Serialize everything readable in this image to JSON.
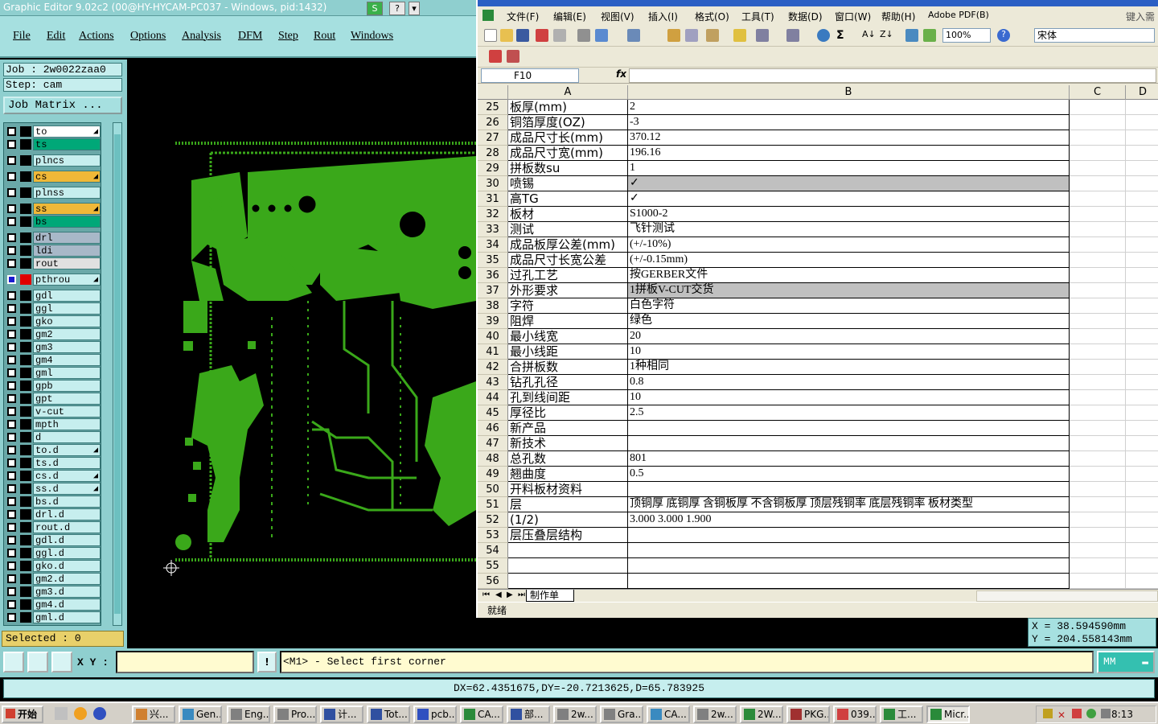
{
  "ge": {
    "title": "Graphic Editor 9.02c2 (00@HY-HYCAM-PC037 - Windows, pid:1432)",
    "menu": [
      "File",
      "Edit",
      "Actions",
      "Options",
      "Analysis",
      "DFM",
      "Step",
      "Rout",
      "Windows"
    ],
    "job": "Job : 2w0022zaa0",
    "step": "Step: cam",
    "job_matrix": "Job Matrix ...",
    "selected": "Selected : 0",
    "layers": [
      {
        "name": "to",
        "bg": "#ffffff",
        "color": "#000000",
        "flag": true,
        "sel": false
      },
      {
        "name": "ts",
        "bg": "#00a878",
        "color": "#000000",
        "flag": false,
        "sel": false
      },
      {
        "name": "plncs",
        "bg": "#c6eeee",
        "color": "#000000",
        "flag": false,
        "sel": false
      },
      {
        "name": "cs",
        "bg": "#f0b838",
        "color": "#00a000",
        "flag": true,
        "sel": false
      },
      {
        "name": "plnss",
        "bg": "#c6eeee",
        "color": "#000000",
        "flag": false,
        "sel": false
      },
      {
        "name": "ss",
        "bg": "#f0b838",
        "color": "#000000",
        "flag": true,
        "sel": false
      },
      {
        "name": "bs",
        "bg": "#00a878",
        "color": "#000000",
        "flag": false,
        "sel": false
      },
      {
        "name": "drl",
        "bg": "#a8b8c8",
        "color": "#000000",
        "flag": false,
        "sel": false
      },
      {
        "name": "ldi",
        "bg": "#a8b8c8",
        "color": "#000000",
        "flag": false,
        "sel": false
      },
      {
        "name": "rout",
        "bg": "#e0e0e0",
        "color": "#000000",
        "flag": false,
        "sel": false
      },
      {
        "name": "pthrou",
        "bg": "#c6eeee",
        "color": "#e00000",
        "flag": true,
        "sel": true
      },
      {
        "name": "gdl",
        "bg": "#c6eeee",
        "color": "#000000",
        "flag": false,
        "sel": false
      },
      {
        "name": "ggl",
        "bg": "#c6eeee",
        "color": "#000000",
        "flag": false,
        "sel": false
      },
      {
        "name": "gko",
        "bg": "#c6eeee",
        "color": "#000000",
        "flag": false,
        "sel": false
      },
      {
        "name": "gm2",
        "bg": "#c6eeee",
        "color": "#000000",
        "flag": false,
        "sel": false
      },
      {
        "name": "gm3",
        "bg": "#c6eeee",
        "color": "#000000",
        "flag": false,
        "sel": false
      },
      {
        "name": "gm4",
        "bg": "#c6eeee",
        "color": "#000000",
        "flag": false,
        "sel": false
      },
      {
        "name": "gml",
        "bg": "#c6eeee",
        "color": "#000000",
        "flag": false,
        "sel": false
      },
      {
        "name": "gpb",
        "bg": "#c6eeee",
        "color": "#000000",
        "flag": false,
        "sel": false
      },
      {
        "name": "gpt",
        "bg": "#c6eeee",
        "color": "#000000",
        "flag": false,
        "sel": false
      },
      {
        "name": "v-cut",
        "bg": "#c6eeee",
        "color": "#000000",
        "flag": false,
        "sel": false
      },
      {
        "name": "mpth",
        "bg": "#c6eeee",
        "color": "#000000",
        "flag": false,
        "sel": false
      },
      {
        "name": "d",
        "bg": "#c6eeee",
        "color": "#000000",
        "flag": false,
        "sel": false
      },
      {
        "name": "to.d",
        "bg": "#c6eeee",
        "color": "#000000",
        "flag": true,
        "sel": false
      },
      {
        "name": "ts.d",
        "bg": "#c6eeee",
        "color": "#000000",
        "flag": false,
        "sel": false
      },
      {
        "name": "cs.d",
        "bg": "#c6eeee",
        "color": "#000000",
        "flag": true,
        "sel": false
      },
      {
        "name": "ss.d",
        "bg": "#c6eeee",
        "color": "#000000",
        "flag": true,
        "sel": false
      },
      {
        "name": "bs.d",
        "bg": "#c6eeee",
        "color": "#000000",
        "flag": false,
        "sel": false
      },
      {
        "name": "drl.d",
        "bg": "#c6eeee",
        "color": "#000000",
        "flag": false,
        "sel": false
      },
      {
        "name": "rout.d",
        "bg": "#c6eeee",
        "color": "#000000",
        "flag": false,
        "sel": false
      },
      {
        "name": "gdl.d",
        "bg": "#c6eeee",
        "color": "#000000",
        "flag": false,
        "sel": false
      },
      {
        "name": "ggl.d",
        "bg": "#c6eeee",
        "color": "#000000",
        "flag": false,
        "sel": false
      },
      {
        "name": "gko.d",
        "bg": "#c6eeee",
        "color": "#000000",
        "flag": false,
        "sel": false
      },
      {
        "name": "gm2.d",
        "bg": "#c6eeee",
        "color": "#000000",
        "flag": false,
        "sel": false
      },
      {
        "name": "gm3.d",
        "bg": "#c6eeee",
        "color": "#000000",
        "flag": false,
        "sel": false
      },
      {
        "name": "gm4.d",
        "bg": "#c6eeee",
        "color": "#000000",
        "flag": false,
        "sel": false
      },
      {
        "name": "gml.d",
        "bg": "#c6eeee",
        "color": "#000000",
        "flag": false,
        "sel": false
      }
    ],
    "coords": {
      "x": "X = 38.594590mm",
      "y": "Y = 204.558143mm"
    },
    "xy_label": "X Y :",
    "prompt": "<M1> - Select first corner",
    "prompt_btn": "!",
    "units": "MM",
    "dx_line": "DX=62.4351675,DY=-20.7213625,D=65.783925",
    "pcb_color": "#3aa81a"
  },
  "excel": {
    "menu": [
      "文件(F)",
      "编辑(E)",
      "视图(V)",
      "插入(I)",
      "格式(O)",
      "工具(T)",
      "数据(D)",
      "窗口(W)",
      "帮助(H)",
      "Adobe PDF(B)"
    ],
    "search_hint": "键入需要",
    "zoom": "100%",
    "font": "宋体",
    "name_box": "F10",
    "fx": "fx",
    "columns": [
      "A",
      "B",
      "C",
      "D"
    ],
    "rows": [
      {
        "n": "25",
        "a": "板厚(mm)",
        "b": "2",
        "gray": false
      },
      {
        "n": "26",
        "a": "铜箔厚度(OZ)",
        "b": "-3",
        "gray": false
      },
      {
        "n": "27",
        "a": "成品尺寸长(mm)",
        "b": "370.12",
        "gray": false
      },
      {
        "n": "28",
        "a": "成品尺寸宽(mm)",
        "b": "196.16",
        "gray": false
      },
      {
        "n": "29",
        "a": "拼板数su",
        "b": "1",
        "gray": false
      },
      {
        "n": "30",
        "a": "喷锡",
        "b": "✓",
        "gray": true
      },
      {
        "n": "31",
        "a": "高TG",
        "b": "✓",
        "gray": false
      },
      {
        "n": "32",
        "a": "板材",
        "b": "S1000-2",
        "gray": false
      },
      {
        "n": "33",
        "a": "测试",
        "b": "飞针测试",
        "gray": false
      },
      {
        "n": "34",
        "a": "成品板厚公差(mm)",
        "b": "(+/-10%)",
        "gray": false
      },
      {
        "n": "35",
        "a": "成品尺寸长宽公差",
        "b": "(+/-0.15mm)",
        "gray": false
      },
      {
        "n": "36",
        "a": "过孔工艺",
        "b": "按GERBER文件",
        "gray": false
      },
      {
        "n": "37",
        "a": "外形要求",
        "b": "1拼板V-CUT交货",
        "gray": true
      },
      {
        "n": "38",
        "a": "字符",
        "b": "白色字符",
        "gray": false
      },
      {
        "n": "39",
        "a": "阻焊",
        "b": "绿色",
        "gray": false
      },
      {
        "n": "40",
        "a": "最小线宽",
        "b": "20",
        "gray": false
      },
      {
        "n": "41",
        "a": "最小线距",
        "b": "10",
        "gray": false
      },
      {
        "n": "42",
        "a": "合拼板数",
        "b": "1种相同",
        "gray": false
      },
      {
        "n": "43",
        "a": "钻孔孔径",
        "b": "0.8",
        "gray": false
      },
      {
        "n": "44",
        "a": "孔到线间距",
        "b": "10",
        "gray": false
      },
      {
        "n": "45",
        "a": "厚径比",
        "b": "2.5",
        "gray": false
      },
      {
        "n": "46",
        "a": "新产品",
        "b": "",
        "gray": false
      },
      {
        "n": "47",
        "a": "新技术",
        "b": "",
        "gray": false
      },
      {
        "n": "48",
        "a": "总孔数",
        "b": "801",
        "gray": false
      },
      {
        "n": "49",
        "a": "翘曲度",
        "b": "0.5",
        "gray": false
      },
      {
        "n": "50",
        "a": "开料板材资料",
        "b": "",
        "gray": false
      },
      {
        "n": "51",
        "a": "层",
        "b": "顶铜厚  底铜厚  含铜板厚  不含铜板厚  顶层残铜率  底层残铜率  板材类型",
        "gray": false
      },
      {
        "n": "52",
        "a": "(1/2)",
        "b": "3.000   3.000    1.900",
        "gray": false
      },
      {
        "n": "53",
        "a": "层压叠层结构",
        "b": "",
        "gray": false
      },
      {
        "n": "54",
        "a": "",
        "b": "",
        "gray": false
      },
      {
        "n": "55",
        "a": "",
        "b": "",
        "gray": false
      },
      {
        "n": "56",
        "a": "",
        "b": "",
        "gray": false
      }
    ],
    "sheet_tab": "制作单",
    "status": "就绪"
  },
  "taskbar": {
    "start": "开始",
    "tasks": [
      "兴...",
      "Gen...",
      "Eng...",
      "Pro...",
      "计...",
      "Tot...",
      "pcb...",
      "CA...",
      "部...",
      "2w...",
      "Gra...",
      "CA...",
      "2w...",
      "2W...",
      "PKG...",
      "039...",
      "工...",
      "Micr..."
    ],
    "clock": "8:13"
  }
}
